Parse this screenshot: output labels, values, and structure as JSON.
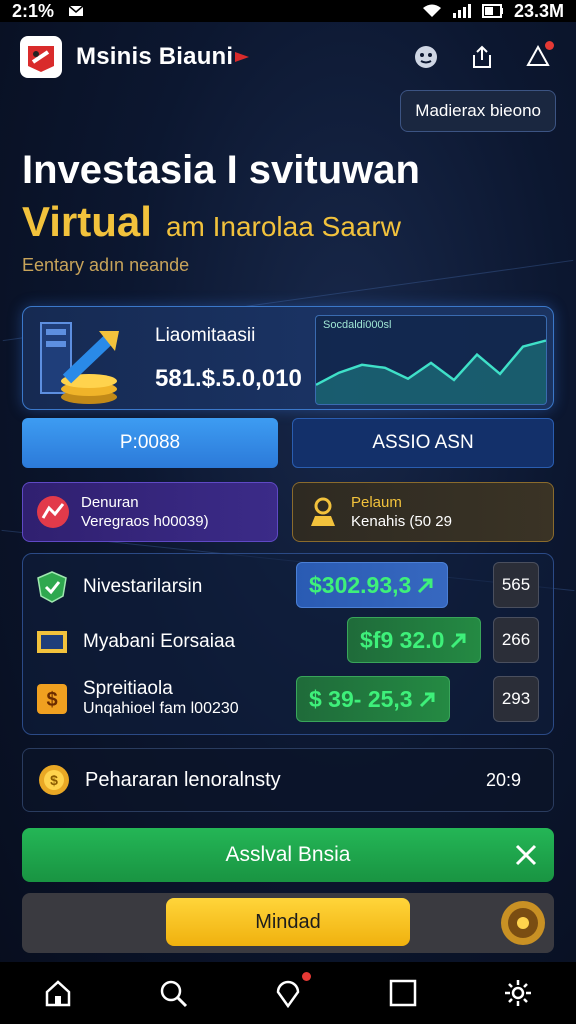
{
  "status_bar": {
    "left_text": "2:1%",
    "right_text": "23.3M"
  },
  "app": {
    "title": "Msinis Biauni"
  },
  "header_button": {
    "label": "Madierax bieono"
  },
  "hero": {
    "title": "Investasia I svituwan",
    "subtitle_gold": "Virtual",
    "subtitle_rest": "am Inarolaa Saarw",
    "tagline": "Eentary adın neande"
  },
  "portfolio": {
    "label": "Liaomitaasii",
    "value": "581.$.5.0,010",
    "chart_label": "Socdaldi000sl",
    "chart_points": [
      0.22,
      0.42,
      0.55,
      0.5,
      0.32,
      0.58,
      0.3,
      0.72,
      0.4,
      0.85,
      0.95
    ]
  },
  "buttons": {
    "primary": "P:0088",
    "secondary": "ASSIO ASN"
  },
  "info_cards": {
    "left": {
      "line1": "Denuran",
      "line2": "Veregraos h00039)"
    },
    "right": {
      "line1": "Pelaum",
      "line2": "Kenahis (50 29"
    }
  },
  "assets": [
    {
      "name": "Nivestarilarsin",
      "sub": "",
      "amount": "$302.93,3",
      "count": "565",
      "style": "blue"
    },
    {
      "name": "Myabani Eorsaiaa",
      "sub": "",
      "amount": "$f9 32.0",
      "count": "266",
      "style": "green"
    },
    {
      "name": "Spreitiaola",
      "sub": "Unqahioel fam l00230",
      "amount": "$ 39- 25,3",
      "count": "293",
      "style": "green"
    }
  ],
  "summary": {
    "label": "Pehararan lenoralnsty",
    "value": "20:9"
  },
  "banner": {
    "label": "Asslval Bnsia"
  },
  "action": {
    "label": "Mindad"
  },
  "colors": {
    "accent_gold": "#f2c23c",
    "accent_green": "#3ef07a",
    "primary_blue": "#3d9cf2"
  },
  "nav": [
    "home-icon",
    "search-icon",
    "location-icon",
    "square-icon",
    "gear-icon"
  ]
}
